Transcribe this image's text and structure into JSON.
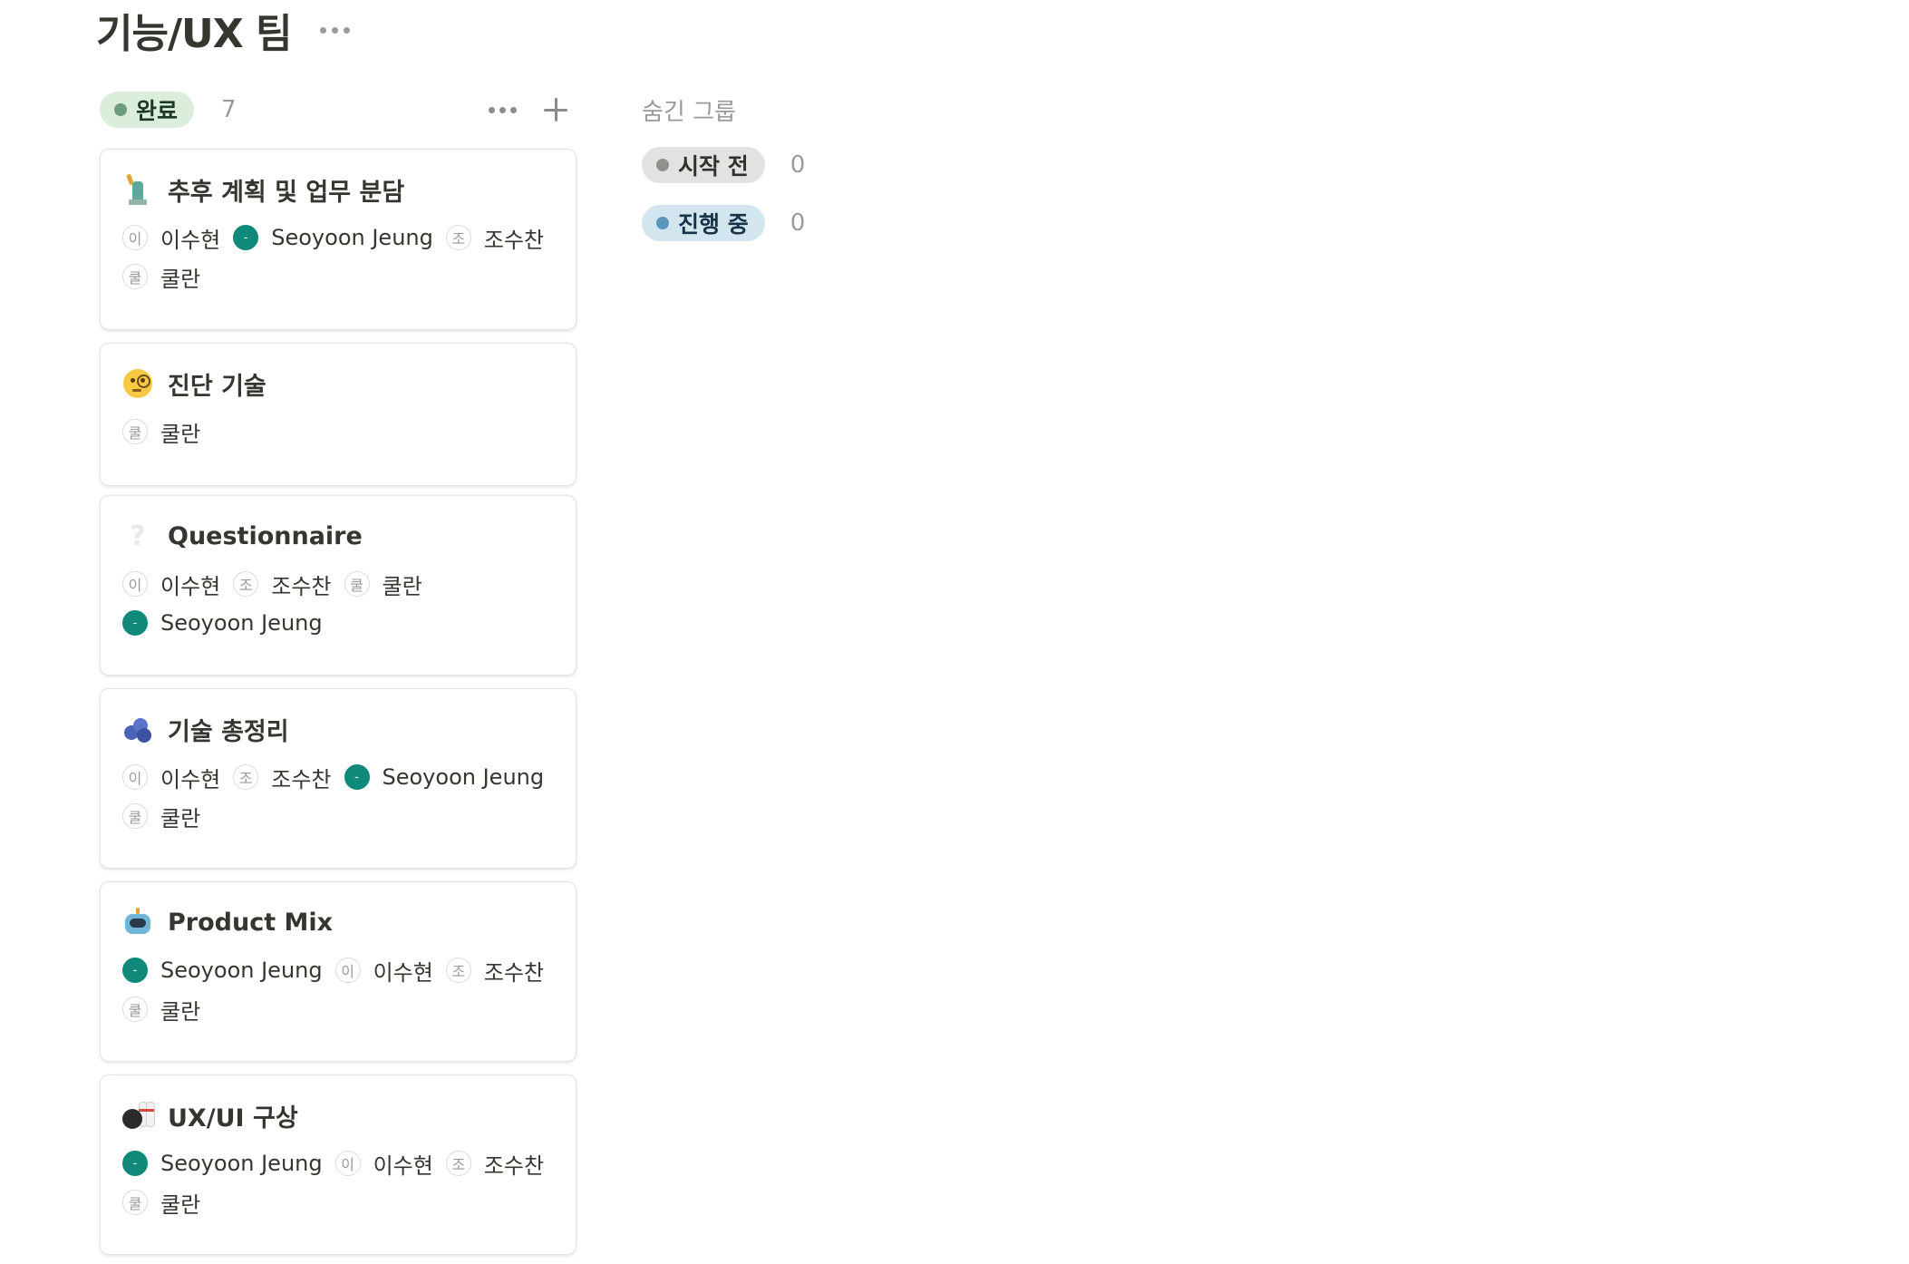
{
  "page": {
    "title": "기능/UX 팀"
  },
  "column": {
    "status": "완료",
    "status_color": "#dbeddb",
    "status_dot_color": "#6c9b7d",
    "count": "7"
  },
  "cards": [
    {
      "title": "추후 계획 및 업무 분담",
      "icon": "statue-of-liberty-icon",
      "people": [
        {
          "initial": "이",
          "name": "이수현",
          "teal": false
        },
        {
          "initial": "-",
          "name": "Seoyoon Jeung",
          "teal": true
        },
        {
          "initial": "조",
          "name": "조수찬",
          "teal": false
        },
        {
          "initial": "쿨",
          "name": "쿨란",
          "teal": false
        }
      ]
    },
    {
      "title": "진단 기술",
      "icon": "face-with-monocle-icon",
      "people": [
        {
          "initial": "쿨",
          "name": "쿨란",
          "teal": false
        }
      ]
    },
    {
      "title": "Questionnaire",
      "icon": "question-mark-icon",
      "people": [
        {
          "initial": "이",
          "name": "이수현",
          "teal": false
        },
        {
          "initial": "조",
          "name": "조수찬",
          "teal": false
        },
        {
          "initial": "쿨",
          "name": "쿨란",
          "teal": false
        },
        {
          "initial": "-",
          "name": "Seoyoon Jeung",
          "teal": true
        }
      ]
    },
    {
      "title": "기술 총정리",
      "icon": "blueberries-icon",
      "people": [
        {
          "initial": "이",
          "name": "이수현",
          "teal": false
        },
        {
          "initial": "조",
          "name": "조수찬",
          "teal": false
        },
        {
          "initial": "-",
          "name": "Seoyoon Jeung",
          "teal": true
        },
        {
          "initial": "쿨",
          "name": "쿨란",
          "teal": false
        }
      ]
    },
    {
      "title": "Product Mix",
      "icon": "robot-icon",
      "people": [
        {
          "initial": "-",
          "name": "Seoyoon Jeung",
          "teal": true
        },
        {
          "initial": "이",
          "name": "이수현",
          "teal": false
        },
        {
          "initial": "조",
          "name": "조수찬",
          "teal": false
        },
        {
          "initial": "쿨",
          "name": "쿨란",
          "teal": false
        }
      ]
    },
    {
      "title": "UX/UI 구상",
      "icon": "bowling-icon",
      "people": [
        {
          "initial": "-",
          "name": "Seoyoon Jeung",
          "teal": true
        },
        {
          "initial": "이",
          "name": "이수현",
          "teal": false
        },
        {
          "initial": "조",
          "name": "조수찬",
          "teal": false
        },
        {
          "initial": "쿨",
          "name": "쿨란",
          "teal": false
        }
      ]
    }
  ],
  "hidden_groups": {
    "label": "숨긴 그룹",
    "groups": [
      {
        "status": "시작 전",
        "count": "0",
        "color": "#e3e2e0",
        "dot_color": "#91918e",
        "text_color": "#32302c"
      },
      {
        "status": "진행 중",
        "count": "0",
        "color": "#d3e5ef",
        "dot_color": "#5b97bd",
        "text_color": "#183347"
      }
    ]
  }
}
